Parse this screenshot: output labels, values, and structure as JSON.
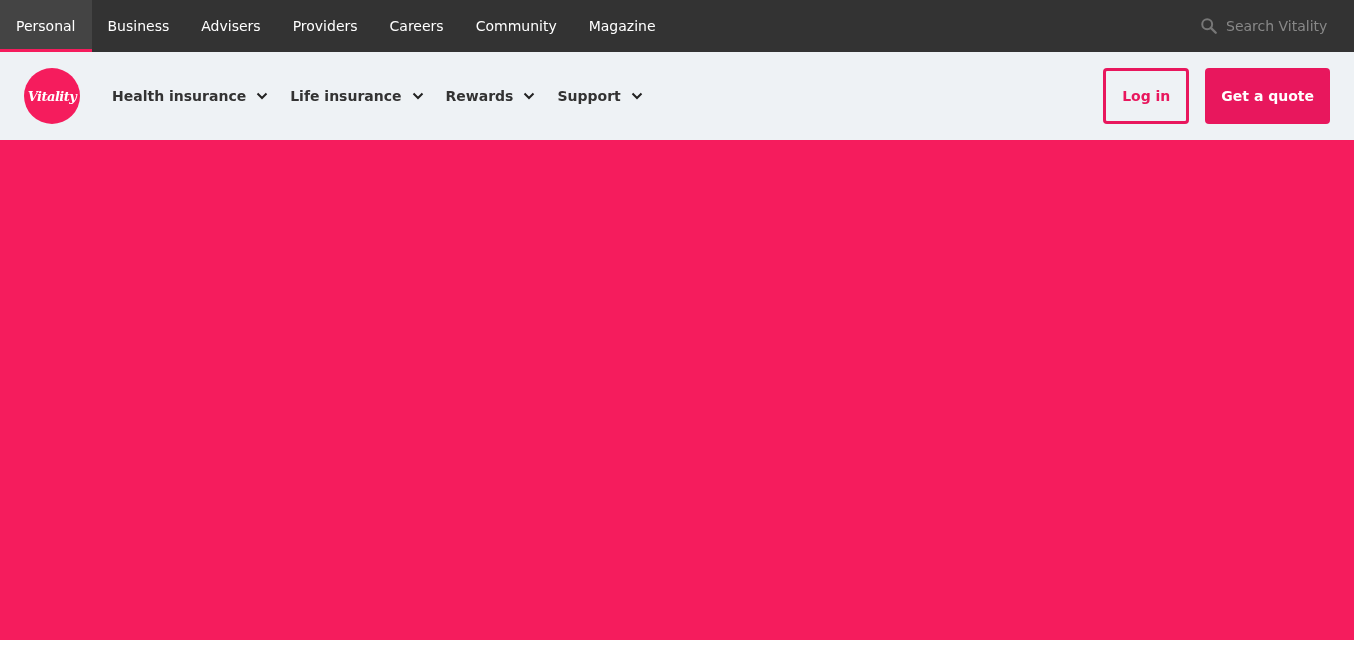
{
  "top_bar": {
    "tabs": [
      {
        "label": "Personal",
        "selected": true
      },
      {
        "label": "Business",
        "selected": false
      },
      {
        "label": "Advisers",
        "selected": false
      },
      {
        "label": "Providers",
        "selected": false
      },
      {
        "label": "Careers",
        "selected": false
      },
      {
        "label": "Community",
        "selected": false
      },
      {
        "label": "Magazine",
        "selected": false
      }
    ],
    "search": {
      "placeholder": "Search Vitality"
    }
  },
  "header": {
    "logo": "Vitality",
    "menu": [
      {
        "label": "Health insurance"
      },
      {
        "label": "Life insurance"
      },
      {
        "label": "Rewards"
      },
      {
        "label": "Support"
      }
    ],
    "buttons": [
      {
        "label": "Log in",
        "kind": "outline"
      },
      {
        "label": "Get a quote",
        "kind": "filled"
      }
    ]
  }
}
